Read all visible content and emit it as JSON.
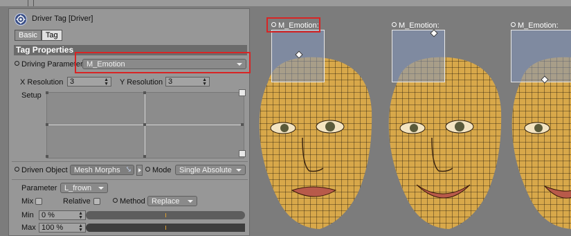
{
  "panel": {
    "title": "Driver Tag [Driver]",
    "tabs": [
      {
        "label": "Basic"
      },
      {
        "label": "Tag"
      }
    ],
    "section_title": "Tag Properties",
    "driving_parameter": {
      "label": "Driving Parameter",
      "value": "M_Emotion"
    },
    "x_resolution": {
      "label": "X Resolution",
      "value": "3"
    },
    "y_resolution": {
      "label": "Y Resolution",
      "value": "3"
    },
    "setup_label": "Setup",
    "driven_object": {
      "label": "Driven Object",
      "value": "Mesh Morphs"
    },
    "mode": {
      "label": "Mode",
      "value": "Single Absolute"
    },
    "parameter": {
      "label": "Parameter",
      "value": "L_frown"
    },
    "mix": {
      "label": "Mix"
    },
    "relative": {
      "label": "Relative"
    },
    "method": {
      "label": "Method",
      "value": "Replace"
    },
    "min": {
      "label": "Min",
      "value": "0 %",
      "level": 0.0
    },
    "max": {
      "label": "Max",
      "value": "100 %",
      "level": 1.0
    }
  },
  "viewport": {
    "controllers": [
      {
        "label": "M_Emotion:"
      },
      {
        "label": "M_Emotion:"
      },
      {
        "label": "M_Emotion:"
      }
    ]
  },
  "colors": {
    "highlight": "#d82424",
    "panel_bg": "#979797",
    "skin": "#d8a84a",
    "wire": "#1a1208"
  }
}
